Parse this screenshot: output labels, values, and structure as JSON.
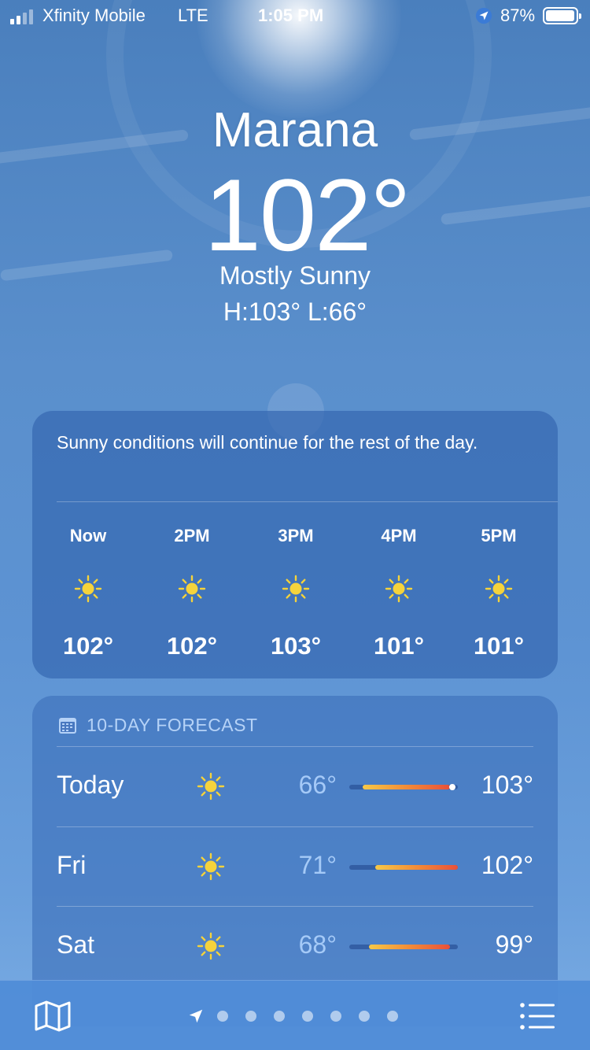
{
  "status_bar": {
    "carrier": "Xfinity Mobile",
    "network": "LTE",
    "time": "1:05 PM",
    "battery_percent": "87%",
    "battery_level": 0.87,
    "signal_bars": 2,
    "location_icon": "location-arrow-icon"
  },
  "location": {
    "city": "Marana",
    "temperature": "102°",
    "condition": "Mostly Sunny",
    "high_low": "H:103°  L:66°"
  },
  "hourly": {
    "summary": "Sunny conditions will continue for the rest of the day.",
    "hours": [
      {
        "label": "Now",
        "icon": "sun-icon",
        "temp": "102°"
      },
      {
        "label": "2PM",
        "icon": "sun-icon",
        "temp": "102°"
      },
      {
        "label": "3PM",
        "icon": "sun-icon",
        "temp": "103°"
      },
      {
        "label": "4PM",
        "icon": "sun-icon",
        "temp": "101°"
      },
      {
        "label": "5PM",
        "icon": "sun-icon",
        "temp": "101°"
      }
    ]
  },
  "daily": {
    "title": "10-DAY FORECAST",
    "icon": "calendar-icon",
    "days": [
      {
        "day": "Today",
        "icon": "sun-icon",
        "low": "66°",
        "high": "103°",
        "range_start": 0.12,
        "range_end": 0.93,
        "current": 0.95
      },
      {
        "day": "Fri",
        "icon": "sun-icon",
        "low": "71°",
        "high": "102°",
        "range_start": 0.24,
        "range_end": 1.0
      },
      {
        "day": "Sat",
        "icon": "sun-icon",
        "low": "68°",
        "high": "99°",
        "range_start": 0.18,
        "range_end": 0.93
      }
    ]
  },
  "toolbar": {
    "map_icon": "map-icon",
    "list_icon": "list-icon",
    "page_count": 7,
    "current_location_icon": "location-arrow-icon"
  },
  "colors": {
    "sun": "#f5d33b",
    "bar_start": "#f7c948",
    "bar_end": "#e8503a",
    "low_temp": "#aacdfa"
  }
}
